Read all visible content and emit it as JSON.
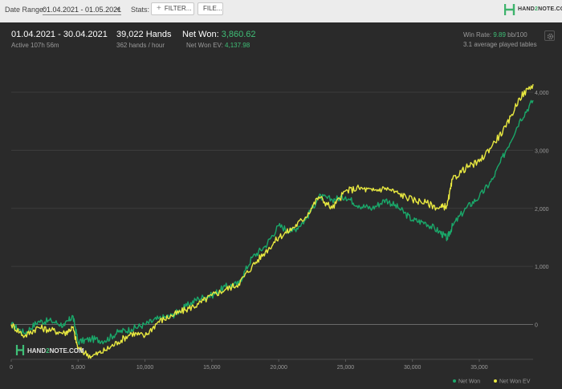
{
  "toolbar": {
    "date_range_label": "Date Range:",
    "date_range_value": "01.04.2021 - 01.05.2021",
    "stats_label": "Stats:",
    "filter_label": "FILTER...",
    "file_label": "FILE..."
  },
  "brand": {
    "name_prefix": "HAND",
    "name_two": "2",
    "name_suffix": "NOTE.COM"
  },
  "summary": {
    "period": "01.04.2021 - 30.04.2021",
    "active": "Active 107h 56m",
    "hands": "39,022 Hands",
    "hands_rate": "362 hands / hour",
    "net_won_label": "Net Won:",
    "net_won_value": "3,860.62",
    "net_won_ev_label": "Net Won  EV:",
    "net_won_ev_value": "4,137.98",
    "win_rate_label": "Win Rate:",
    "win_rate_value": "9.89",
    "win_rate_unit": "bb/100",
    "avg_tables": "3.1 average played tables"
  },
  "colors": {
    "net_won": "#1aa86a",
    "net_won_ev": "#e8e840",
    "panel_bg": "#2a2a2a",
    "accent_green": "#3fbf77"
  },
  "icons": [
    "gear-icon",
    "hand2note-logo-icon"
  ],
  "chart_data": {
    "type": "line",
    "title": "",
    "xlabel": "",
    "ylabel": "",
    "xlim": [
      0,
      39022
    ],
    "ylim": [
      -600,
      4400
    ],
    "x_ticks": [
      0,
      5000,
      10000,
      15000,
      20000,
      25000,
      30000,
      35000
    ],
    "x_tick_labels": [
      "0",
      "5,000",
      "10,000",
      "15,000",
      "20,000",
      "25,000",
      "30,000",
      "35,000"
    ],
    "y_ticks": [
      0,
      1000,
      2000,
      3000,
      4000
    ],
    "y_tick_labels": [
      "0",
      "1,000",
      "2,000",
      "3,000",
      "4,000"
    ],
    "grid": true,
    "legend_position": "bottom-right",
    "series": [
      {
        "name": "Net Won",
        "color": "#1aa86a",
        "x": [
          0,
          1000,
          2000,
          3000,
          4000,
          4600,
          5000,
          6000,
          7000,
          8000,
          9000,
          10000,
          11000,
          12000,
          13000,
          14000,
          15000,
          16000,
          17000,
          18000,
          19000,
          20000,
          21000,
          22000,
          23000,
          24000,
          25000,
          26000,
          27000,
          28000,
          29000,
          30000,
          31000,
          32000,
          32600,
          33000,
          34000,
          35000,
          36000,
          37000,
          38000,
          39022
        ],
        "y": [
          0,
          -150,
          50,
          60,
          -20,
          150,
          -300,
          -250,
          -280,
          -130,
          -80,
          0,
          100,
          150,
          300,
          450,
          500,
          650,
          700,
          1150,
          1350,
          1700,
          1600,
          1800,
          2200,
          2150,
          2200,
          2050,
          2000,
          2150,
          2000,
          1800,
          1750,
          1600,
          1480,
          1700,
          2000,
          2200,
          2500,
          3000,
          3500,
          3860
        ]
      },
      {
        "name": "Net Won  EV",
        "color": "#e8e840",
        "x": [
          0,
          1000,
          2000,
          3000,
          4000,
          4600,
          5000,
          6000,
          7000,
          8000,
          9000,
          10000,
          11000,
          12000,
          13000,
          14000,
          15000,
          16000,
          17000,
          18000,
          19000,
          20000,
          21000,
          22000,
          23000,
          24000,
          25000,
          26000,
          27000,
          28000,
          29000,
          30000,
          31000,
          32000,
          32600,
          33000,
          34000,
          35000,
          36000,
          37000,
          38000,
          39022
        ],
        "y": [
          0,
          -200,
          -50,
          -100,
          -150,
          -50,
          -420,
          -550,
          -450,
          -300,
          -150,
          -200,
          50,
          150,
          250,
          350,
          500,
          600,
          700,
          1000,
          1250,
          1500,
          1650,
          1850,
          2200,
          2000,
          2300,
          2350,
          2300,
          2350,
          2250,
          2150,
          2100,
          2000,
          2050,
          2500,
          2700,
          2800,
          3100,
          3400,
          3900,
          4138
        ]
      }
    ]
  }
}
